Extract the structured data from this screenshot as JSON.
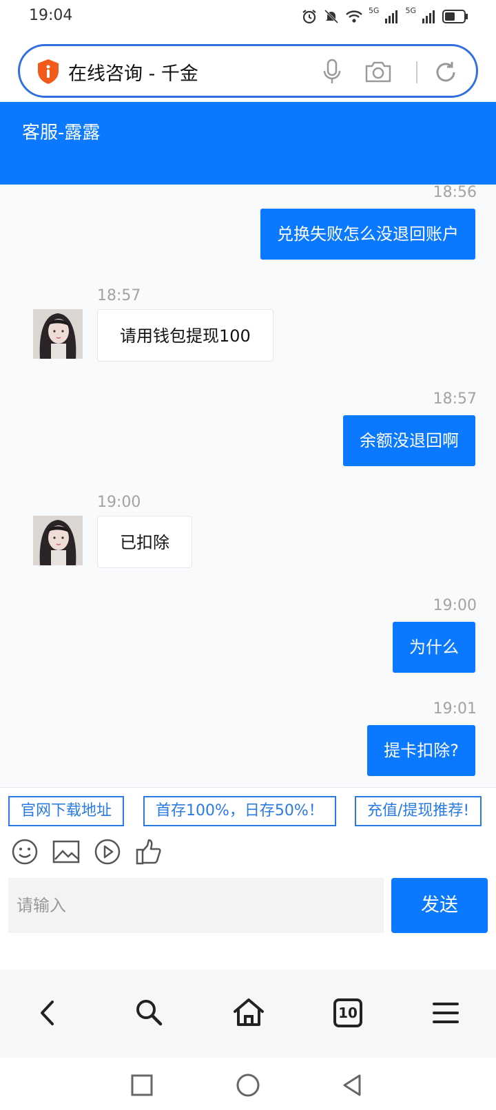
{
  "status_bar": {
    "time": "19:04",
    "icons": [
      "alarm-icon",
      "mute-icon",
      "wifi-icon",
      "signal-5g-icon",
      "signal-5g-icon",
      "battery-icon"
    ],
    "signal_label_1": "5G",
    "signal_label_2": "5G"
  },
  "browser": {
    "page_title": "在线咨询 - 千金",
    "tab_count": "10",
    "icons": {
      "security": "shield-icon",
      "voice": "mic-icon",
      "camera": "camera-icon",
      "refresh": "refresh-icon",
      "back": "back-icon",
      "search": "search-icon",
      "home": "home-icon",
      "tabs": "tabs-icon",
      "menu": "menu-icon"
    }
  },
  "chat": {
    "agent_name": "客服-露露",
    "messages": [
      {
        "direction": "out",
        "time": "18:56",
        "text": "兑换失败怎么没退回账户"
      },
      {
        "direction": "in",
        "time": "18:57",
        "text": "请用钱包提现100"
      },
      {
        "direction": "out",
        "time": "18:57",
        "text": "余额没退回啊"
      },
      {
        "direction": "in",
        "time": "19:00",
        "text": "已扣除"
      },
      {
        "direction": "out",
        "time": "19:00",
        "text": "为什么"
      },
      {
        "direction": "out",
        "time": "19:01",
        "text": "提卡扣除?"
      }
    ],
    "quick_replies": [
      "官网下载地址",
      "首存100%，日存50%！",
      "充值/提现推荐!"
    ],
    "tools": [
      "emoji-icon",
      "image-icon",
      "video-icon",
      "thumbs-up-icon"
    ],
    "input_placeholder": "请输入",
    "send_label": "发送"
  },
  "system_nav": [
    "recent-apps-icon",
    "home-circle-icon",
    "back-triangle-icon"
  ],
  "colors": {
    "accent": "#0a78ff",
    "url_border": "#2f6fe0",
    "shield": "#f25a1a"
  }
}
